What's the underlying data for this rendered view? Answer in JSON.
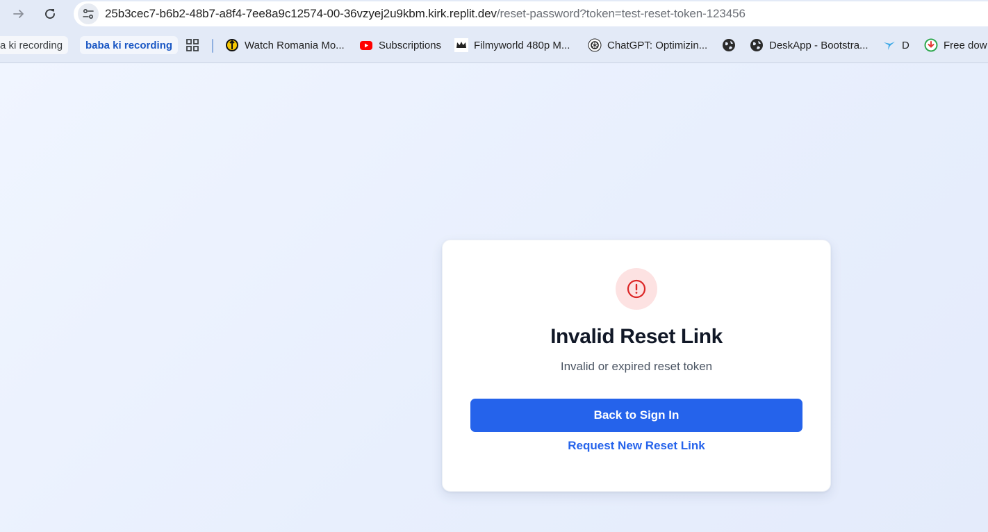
{
  "browser": {
    "url_host": "25b3cec7-b6b2-48b7-a8f4-7ee8a9c12574-00-36vzyej2u9kbm.kirk.replit.dev",
    "url_path": "/reset-password?token=test-reset-token-123456"
  },
  "bookmarks": [
    {
      "label": "a ki recording",
      "style": "chip"
    },
    {
      "label": "baba ki recording",
      "style": "chip-active"
    },
    {
      "label": "",
      "icon": "apps-grid-icon"
    },
    {
      "label": "Watch Romania Mo...",
      "icon": "tubi-icon"
    },
    {
      "label": "Subscriptions",
      "icon": "youtube-icon"
    },
    {
      "label": "Filmyworld 480p M...",
      "icon": "crown-icon"
    },
    {
      "label": "ChatGPT: Optimizin...",
      "icon": "chatgpt-icon"
    },
    {
      "label": "",
      "icon": "globe-icon"
    },
    {
      "label": "DeskApp - Bootstra...",
      "icon": "globe-icon"
    },
    {
      "label": "D",
      "icon": "bird-icon"
    },
    {
      "label": "Free dow",
      "icon": "download-icon"
    }
  ],
  "card": {
    "title": "Invalid Reset Link",
    "message": "Invalid or expired reset token",
    "primary_button": "Back to Sign In",
    "secondary_link": "Request New Reset Link"
  },
  "colors": {
    "primary": "#2563eb",
    "error_bg": "#fde2e2",
    "error_icon": "#dc2626"
  }
}
